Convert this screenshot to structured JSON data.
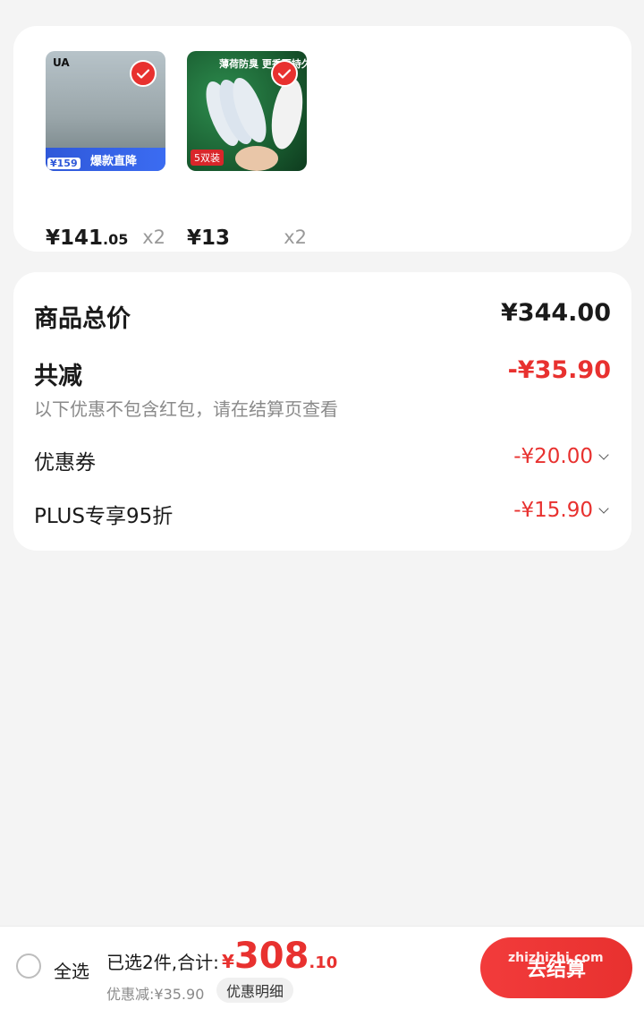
{
  "products": [
    {
      "price_int": "¥141",
      "price_dec": ".05",
      "qty": "x2",
      "thumb_brand": "UA",
      "thumb_price": "¥159",
      "thumb_banner": "爆款直降",
      "selected": true
    },
    {
      "price_int": "¥13",
      "price_dec": "",
      "qty": "x2",
      "thumb_headline": "薄荷防臭 更香更持久",
      "thumb_tag": "5双装",
      "selected": true
    }
  ],
  "summary": {
    "total_label": "商品总价",
    "total_value": "¥344.00",
    "reduce_label": "共减",
    "reduce_value": "-¥35.90",
    "note": "以下优惠不包含红包，请在结算页查看",
    "coupon_label": "优惠券",
    "coupon_value": "-¥20.00",
    "plus_label": "PLUS专享95折",
    "plus_value": "-¥15.90"
  },
  "bottom": {
    "select_all": "全选",
    "selected_text": "已选2件,合计:",
    "total_currency": "¥",
    "total_int": "308",
    "total_dec": ".10",
    "discount_text": "优惠减:¥35.90",
    "detail_button": "优惠明细",
    "checkout_button": "去结算"
  },
  "watermark": "zhizhizhi.com",
  "colors": {
    "accent": "#e8312f",
    "background": "#f4f4f4"
  }
}
